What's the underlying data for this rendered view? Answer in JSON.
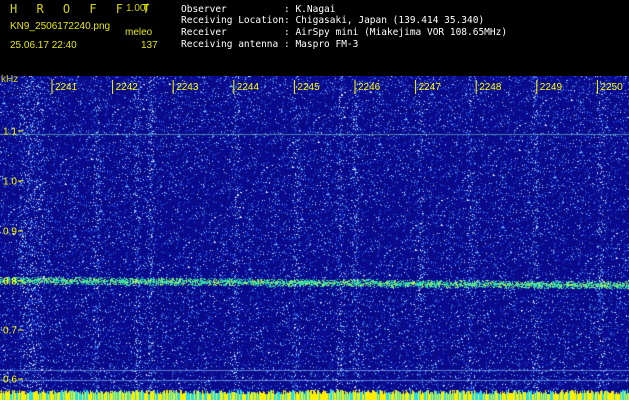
{
  "header": {
    "brand": "H R O F F T",
    "version": "1.00f",
    "filename": "KN9_2506172240.png",
    "meleo_label": "meleo",
    "datetime": "25.06.17 22:40",
    "count": "137"
  },
  "info": {
    "observer_label": "Observer",
    "observer_value": ": K.Nagai",
    "location_label": "Receiving Location",
    "location_value": ": Chigasaki, Japan (139.414 35.340)",
    "receiver_label": "Receiver",
    "receiver_value": ": AirSpy mini (Miakejima VOR 108.65MHz)",
    "antenna_label": "Receiving antenna",
    "antenna_value": ": Maspro FM-3"
  },
  "axis": {
    "unit": "kHz",
    "y_ticks": [
      "1.1",
      "1.0",
      "0.9",
      "0.8",
      "0.7",
      "0.6"
    ],
    "x_ticks": [
      "2241",
      "2242",
      "2243",
      "2244",
      "2245",
      "2246",
      "2247",
      "2248",
      "2249",
      "2250"
    ]
  },
  "colors": {
    "background": "#000000",
    "waterfall_base": "#0a0a8c",
    "signal_line": "#33ddaa",
    "tick_color": "#ffff00",
    "bottom_bar": "#ffee00"
  }
}
